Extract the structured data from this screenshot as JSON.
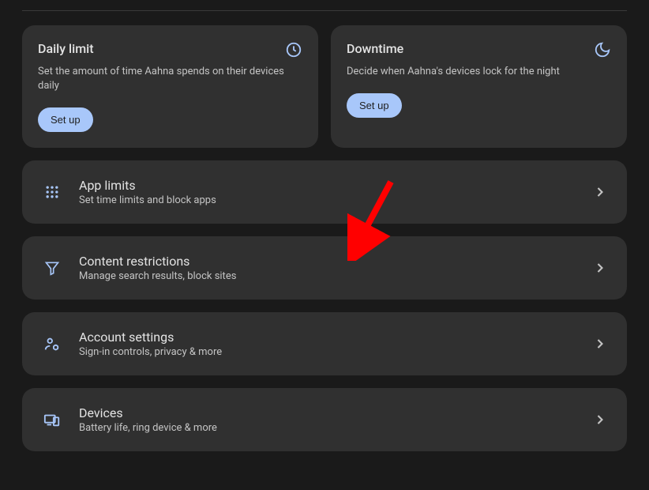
{
  "colors": {
    "accent": "#a8c7fa",
    "arrow": "#ff0000"
  },
  "topCards": [
    {
      "title": "Daily limit",
      "description": "Set the amount of time Aahna spends on their devices daily",
      "button": "Set up",
      "icon": "clock-icon"
    },
    {
      "title": "Downtime",
      "description": "Decide when Aahna's devices lock for the night",
      "button": "Set up",
      "icon": "moon-icon"
    }
  ],
  "rows": [
    {
      "title": "App limits",
      "description": "Set time limits and block apps",
      "icon": "apps-grid-icon"
    },
    {
      "title": "Content restrictions",
      "description": "Manage search results, block sites",
      "icon": "filter-icon"
    },
    {
      "title": "Account settings",
      "description": "Sign-in controls, privacy & more",
      "icon": "account-gear-icon"
    },
    {
      "title": "Devices",
      "description": "Battery life, ring device & more",
      "icon": "devices-icon"
    }
  ]
}
